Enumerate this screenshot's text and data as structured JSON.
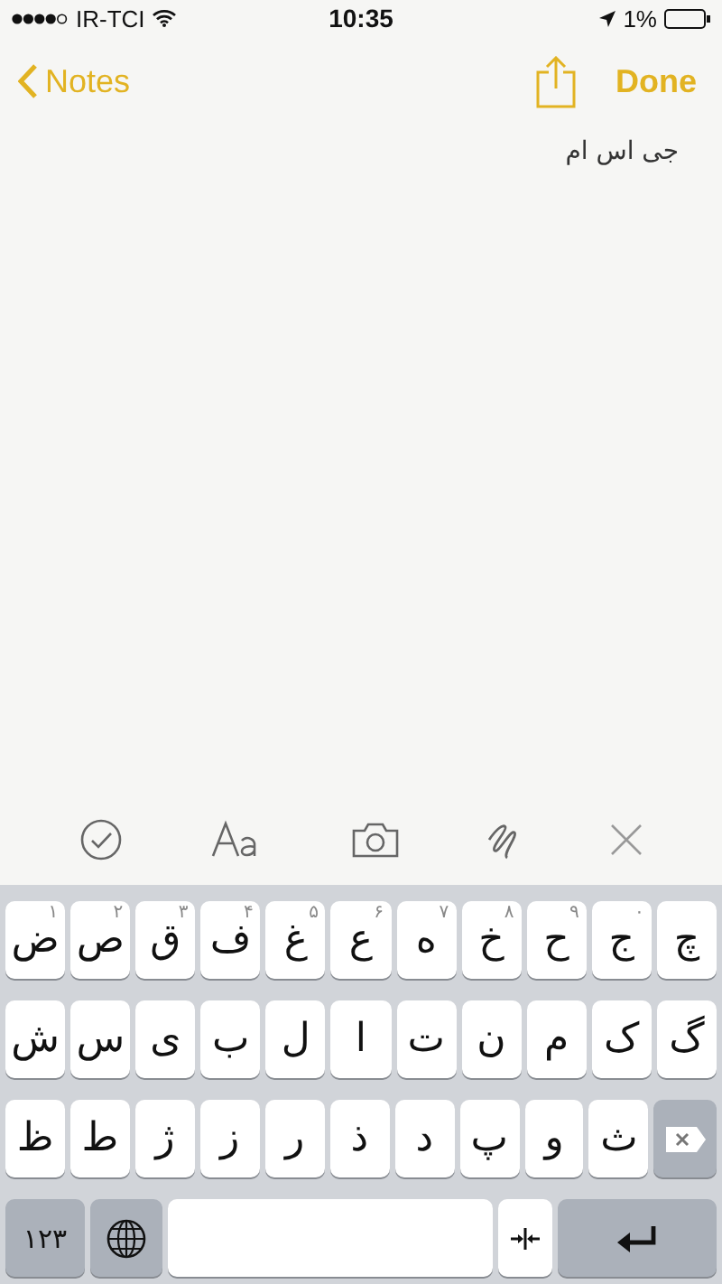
{
  "status_bar": {
    "carrier": "IR-TCI",
    "time": "10:35",
    "battery": "1%"
  },
  "nav_bar": {
    "back": "Notes",
    "done": "Done"
  },
  "note": {
    "text": "جی اس ام"
  },
  "keyboard": {
    "rows": [
      [
        {
          "char": "چ"
        },
        {
          "char": "ج",
          "hint": "۰"
        },
        {
          "char": "ح",
          "hint": "۹"
        },
        {
          "char": "خ",
          "hint": "۸"
        },
        {
          "char": "ه",
          "hint": "۷"
        },
        {
          "char": "ع",
          "hint": "۶"
        },
        {
          "char": "غ",
          "hint": "۵"
        },
        {
          "char": "ف",
          "hint": "۴"
        },
        {
          "char": "ق",
          "hint": "۳"
        },
        {
          "char": "ص",
          "hint": "۲"
        },
        {
          "char": "ض",
          "hint": "۱"
        }
      ],
      [
        {
          "char": "گ"
        },
        {
          "char": "ک"
        },
        {
          "char": "م"
        },
        {
          "char": "ن"
        },
        {
          "char": "ت"
        },
        {
          "char": "ا"
        },
        {
          "char": "ل"
        },
        {
          "char": "ب"
        },
        {
          "char": "ی"
        },
        {
          "char": "س"
        },
        {
          "char": "ش"
        }
      ],
      [
        {
          "kind": "delete"
        },
        {
          "char": "ث"
        },
        {
          "char": "و"
        },
        {
          "char": "پ"
        },
        {
          "char": "د"
        },
        {
          "char": "ذ"
        },
        {
          "char": "ر"
        },
        {
          "char": "ز"
        },
        {
          "char": "ژ"
        },
        {
          "char": "ط"
        },
        {
          "char": "ظ"
        }
      ]
    ],
    "numbers_key": "۱۲۳"
  }
}
